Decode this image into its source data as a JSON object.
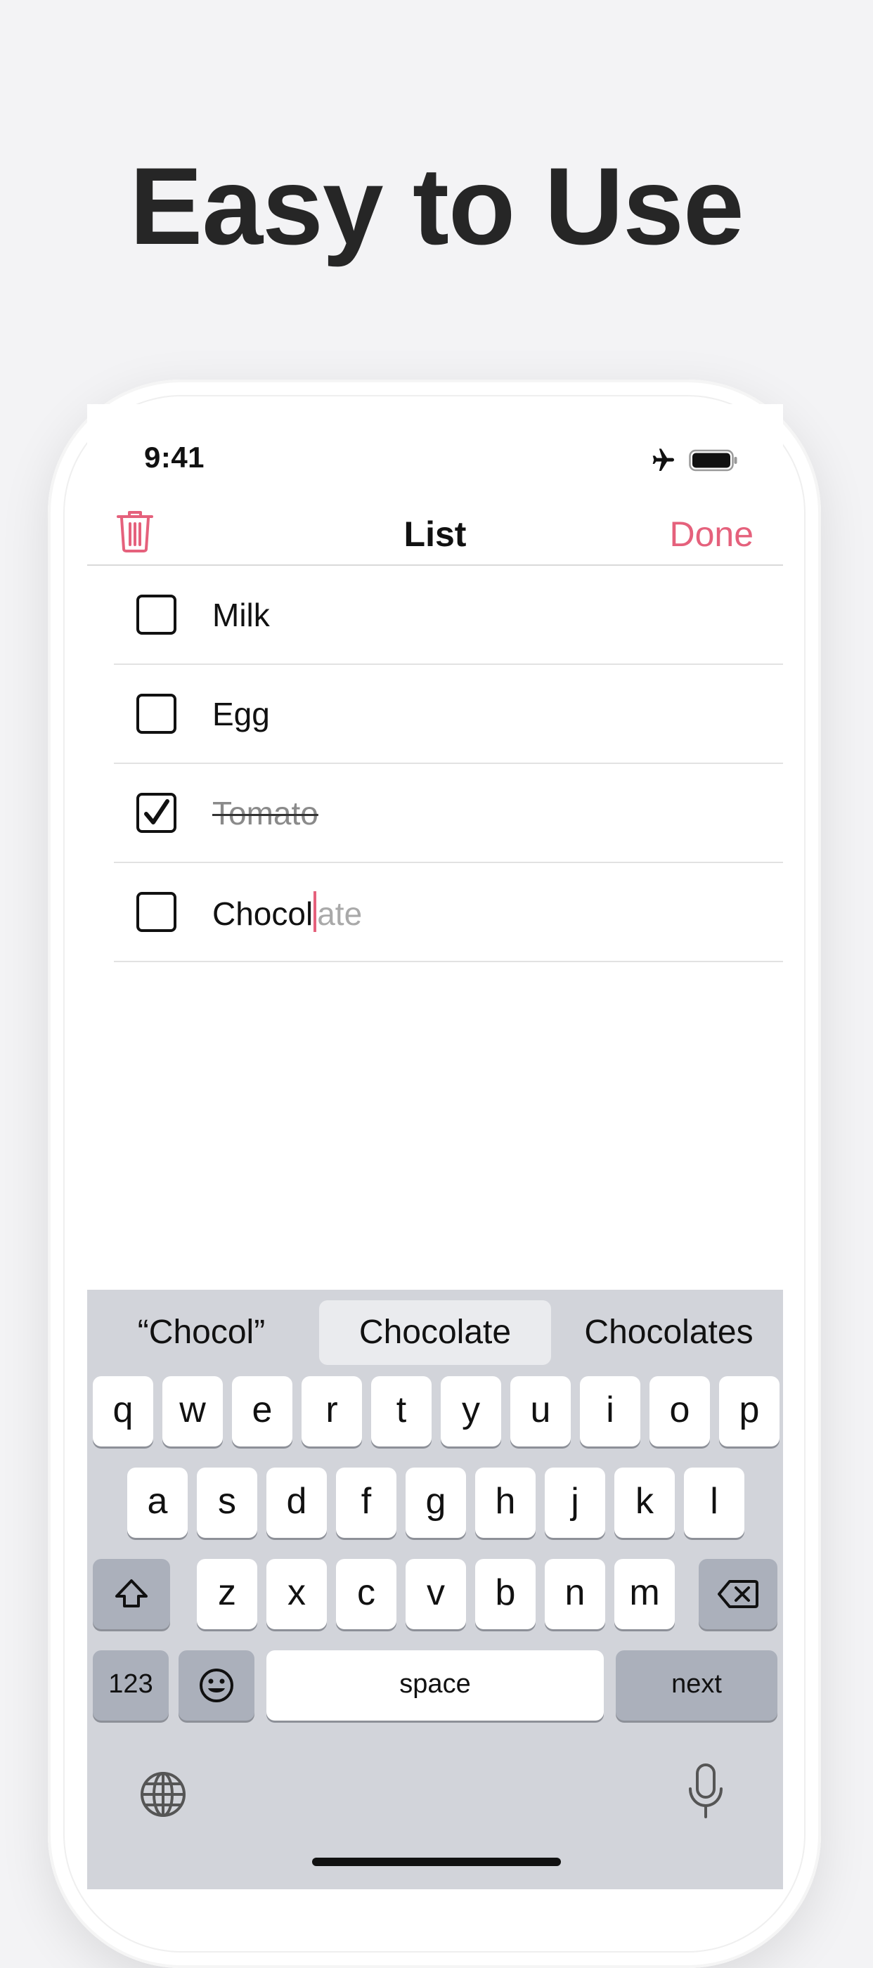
{
  "headline": "Easy to Use",
  "status_bar": {
    "time": "9:41",
    "icons": [
      "airplane-icon",
      "battery-icon"
    ]
  },
  "navbar": {
    "title": "List",
    "done_label": "Done",
    "left_icon": "trash-icon"
  },
  "list": {
    "items": [
      {
        "text": "Milk",
        "checked": false
      },
      {
        "text": "Egg",
        "checked": false
      },
      {
        "text": "Tomato",
        "checked": true
      },
      {
        "typed": "Chocol",
        "ghost": "ate",
        "checked": false
      }
    ]
  },
  "keyboard": {
    "suggestions": [
      "“Chocol”",
      "Chocolate",
      "Chocolates"
    ],
    "row1": [
      "q",
      "w",
      "e",
      "r",
      "t",
      "y",
      "u",
      "i",
      "o",
      "p"
    ],
    "row2": [
      "a",
      "s",
      "d",
      "f",
      "g",
      "h",
      "j",
      "k",
      "l"
    ],
    "row3": [
      "z",
      "x",
      "c",
      "v",
      "b",
      "n",
      "m"
    ],
    "numbers_label": "123",
    "space_label": "space",
    "next_label": "next",
    "icons": [
      "shift-icon",
      "delete-icon",
      "emoji-icon",
      "globe-icon",
      "microphone-icon"
    ]
  },
  "colors": {
    "accent": "#e5617c",
    "keyboard_bg": "#d2d4da",
    "background": "#f3f3f5"
  }
}
